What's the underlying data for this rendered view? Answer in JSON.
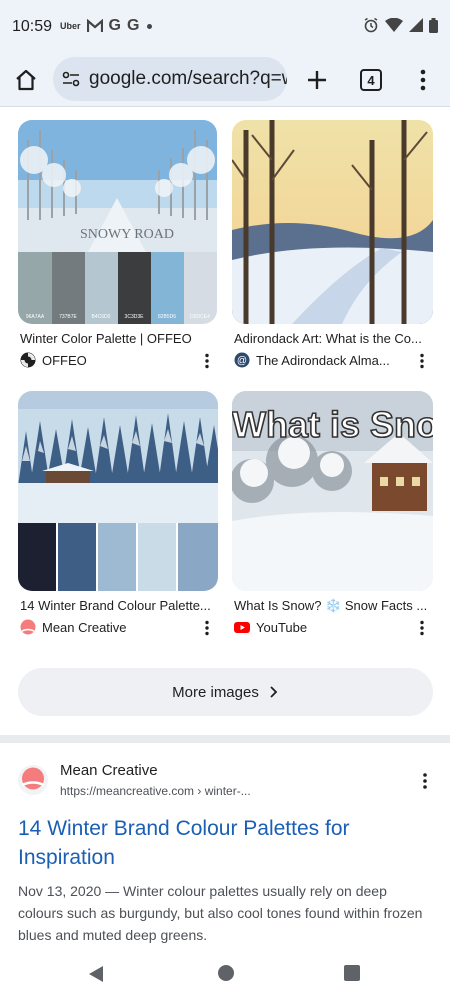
{
  "status_bar": {
    "time": "10:59",
    "notifications": [
      "Uber",
      "gmail-icon",
      "G",
      "G",
      "dot"
    ],
    "icons": [
      "alarm-icon",
      "wifi-icon",
      "signal-icon",
      "battery-icon"
    ]
  },
  "toolbar": {
    "url": "google.com/search?q=w",
    "tab_count": "4"
  },
  "image_results": [
    {
      "title": "Winter Color Palette | OFFEO",
      "source": "OFFEO",
      "overlay_text": "SNOWY ROAD",
      "swatch_codes": [
        "96A7AA",
        "737B7E",
        "B4C6D0",
        "3C3D3E",
        "82B5D6",
        "D5DCE4"
      ]
    },
    {
      "title": "Adirondack Art: What is the Co...",
      "source": "The Adirondack Alma..."
    },
    {
      "title": "14 Winter Brand Colour Palette...",
      "source": "Mean Creative"
    },
    {
      "title": "What Is Snow? ❄️ Snow Facts ...",
      "source": "YouTube",
      "overlay_text": "What is Snow"
    }
  ],
  "more_images": {
    "label": "More images"
  },
  "result": {
    "site_name": "Mean Creative",
    "url": "https://meancreative.com › winter-...",
    "title": "14 Winter Brand Colour Palettes for Inspiration",
    "snippet": "Nov 13, 2020 — Winter colour palettes usually rely on deep colours such as burgundy, but also cool tones found within frozen blues and muted deep greens."
  },
  "colors": {
    "chrome_bg": "#eef3f9",
    "url_bar_bg": "#dbe4ef",
    "link_blue": "#1a5fb4",
    "youtube_red": "#ff0000",
    "mean_creative_pink": "#f47c7c"
  }
}
